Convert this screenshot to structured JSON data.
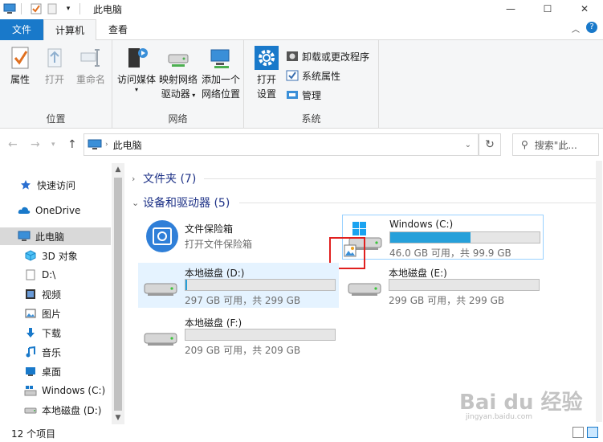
{
  "window": {
    "title": "此电脑",
    "minimize": "—",
    "maximize": "☐",
    "close": "✕"
  },
  "ribbon_tabs": [
    {
      "label": "文件"
    },
    {
      "label": "计算机"
    },
    {
      "label": "查看"
    }
  ],
  "ribbon": {
    "location": {
      "label": "位置",
      "buttons": [
        "属性",
        "打开",
        "重命名"
      ]
    },
    "network": {
      "label": "网络",
      "access_media": "访问媒体",
      "map_drive_1": "映射网络",
      "map_drive_2": "驱动器",
      "add_location_1": "添加一个",
      "add_location_2": "网络位置"
    },
    "system": {
      "label": "系统",
      "open_settings_1": "打开",
      "open_settings_2": "设置",
      "uninstall": "卸载或更改程序",
      "sys_props": "系统属性",
      "manage": "管理"
    }
  },
  "address": {
    "path": "此电脑",
    "search_placeholder": "搜索\"此..."
  },
  "nav": {
    "items": [
      {
        "label": "快速访问"
      },
      {
        "label": "OneDrive"
      },
      {
        "label": "此电脑"
      },
      {
        "label": "3D 对象"
      },
      {
        "label": "D:\\"
      },
      {
        "label": "视频"
      },
      {
        "label": "图片"
      },
      {
        "label": "下载"
      },
      {
        "label": "音乐"
      },
      {
        "label": "桌面"
      },
      {
        "label": "Windows (C:)"
      },
      {
        "label": "本地磁盘 (D:)"
      }
    ]
  },
  "content": {
    "folders_group": "文件夹 (7)",
    "devices_group": "设备和驱动器 (5)",
    "vault": {
      "name": "文件保险箱",
      "desc": "打开文件保险箱"
    },
    "drives": [
      {
        "name": "Windows (C:)",
        "size": "46.0 GB 可用，共 99.9 GB",
        "used_fraction": 0.54
      },
      {
        "name": "本地磁盘 (D:)",
        "size": "297 GB 可用，共 299 GB",
        "used_fraction": 0.01
      },
      {
        "name": "本地磁盘 (E:)",
        "size": "299 GB 可用，共 299 GB",
        "used_fraction": 0.0
      },
      {
        "name": "本地磁盘 (F:)",
        "size": "209 GB 可用，共 209 GB",
        "used_fraction": 0.0
      }
    ]
  },
  "status": {
    "count": "12 个项目"
  },
  "watermark": {
    "text": "Bai du 经验",
    "sub": "jingyan.baidu.com"
  },
  "colors": {
    "accent": "#1979ca",
    "progress": "#26a0da",
    "highlight": "#e0201f",
    "heading": "#1e3287"
  }
}
